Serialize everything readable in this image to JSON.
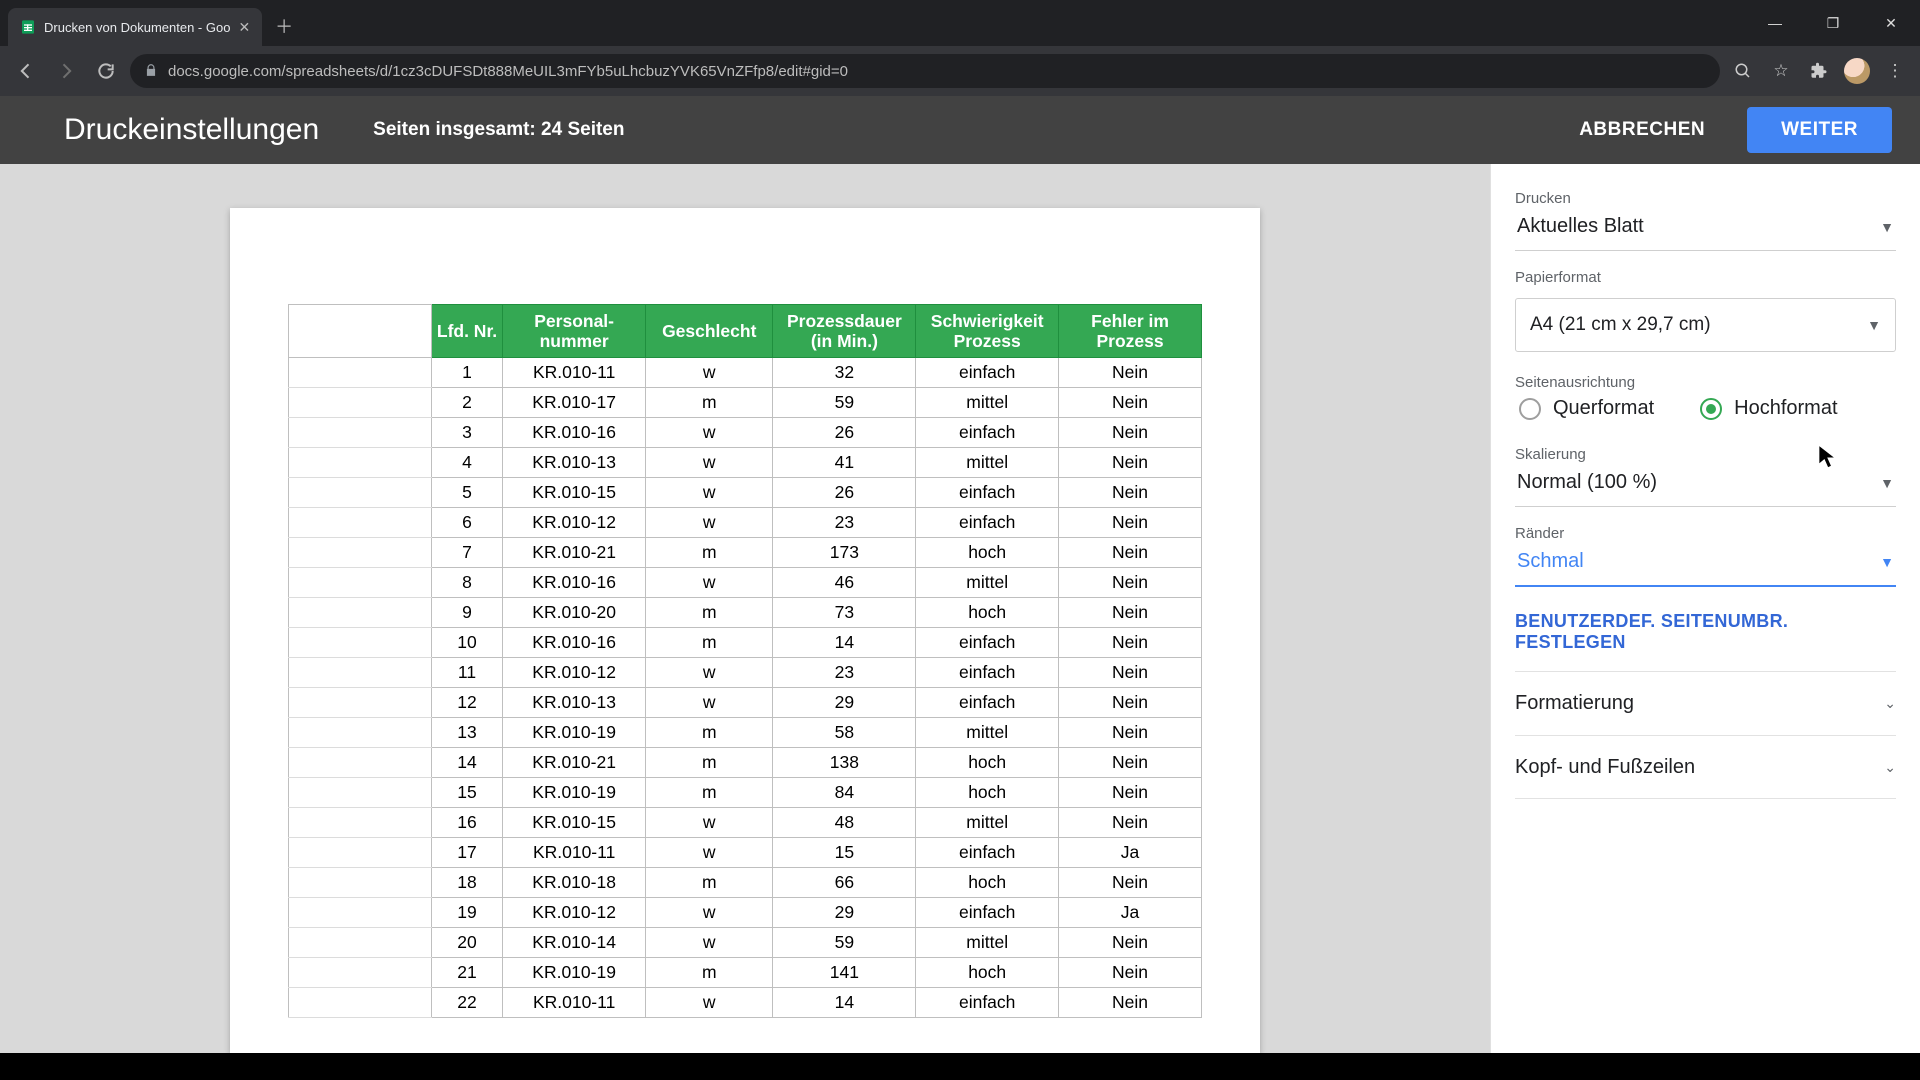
{
  "browser": {
    "tab_title": "Drucken von Dokumenten - Goo",
    "url": "docs.google.com/spreadsheets/d/1cz3cDUFSDt888MeUIL3mFYb5uLhcbuzYVK65VnZFfp8/edit#gid=0"
  },
  "bar": {
    "title": "Druckeinstellungen",
    "pages": "Seiten insgesamt: 24 Seiten",
    "cancel": "ABBRECHEN",
    "next": "WEITER"
  },
  "sidebar": {
    "print_label": "Drucken",
    "print_value": "Aktuelles Blatt",
    "paper_label": "Papierformat",
    "paper_value": "A4 (21 cm x 29,7 cm)",
    "orient_label": "Seitenausrichtung",
    "orient_landscape": "Querformat",
    "orient_portrait": "Hochformat",
    "scale_label": "Skalierung",
    "scale_value": "Normal (100 %)",
    "margin_label": "Ränder",
    "margin_value": "Schmal",
    "pagebreak": "BENUTZERDEF. SEITENUMBR. FESTLEGEN",
    "formatting": "Formatierung",
    "hf": "Kopf- und Fußzeilen"
  },
  "sheet": {
    "headers": [
      "Lfd. Nr.",
      "Personal-nummer",
      "Geschlecht",
      "Prozessdauer (in Min.)",
      "Schwierigkeit Prozess",
      "Fehler im Prozess"
    ],
    "rows": [
      [
        "1",
        "KR.010-11",
        "w",
        "32",
        "einfach",
        "Nein"
      ],
      [
        "2",
        "KR.010-17",
        "m",
        "59",
        "mittel",
        "Nein"
      ],
      [
        "3",
        "KR.010-16",
        "w",
        "26",
        "einfach",
        "Nein"
      ],
      [
        "4",
        "KR.010-13",
        "w",
        "41",
        "mittel",
        "Nein"
      ],
      [
        "5",
        "KR.010-15",
        "w",
        "26",
        "einfach",
        "Nein"
      ],
      [
        "6",
        "KR.010-12",
        "w",
        "23",
        "einfach",
        "Nein"
      ],
      [
        "7",
        "KR.010-21",
        "m",
        "173",
        "hoch",
        "Nein"
      ],
      [
        "8",
        "KR.010-16",
        "w",
        "46",
        "mittel",
        "Nein"
      ],
      [
        "9",
        "KR.010-20",
        "m",
        "73",
        "hoch",
        "Nein"
      ],
      [
        "10",
        "KR.010-16",
        "m",
        "14",
        "einfach",
        "Nein"
      ],
      [
        "11",
        "KR.010-12",
        "w",
        "23",
        "einfach",
        "Nein"
      ],
      [
        "12",
        "KR.010-13",
        "w",
        "29",
        "einfach",
        "Nein"
      ],
      [
        "13",
        "KR.010-19",
        "m",
        "58",
        "mittel",
        "Nein"
      ],
      [
        "14",
        "KR.010-21",
        "m",
        "138",
        "hoch",
        "Nein"
      ],
      [
        "15",
        "KR.010-19",
        "m",
        "84",
        "hoch",
        "Nein"
      ],
      [
        "16",
        "KR.010-15",
        "w",
        "48",
        "mittel",
        "Nein"
      ],
      [
        "17",
        "KR.010-11",
        "w",
        "15",
        "einfach",
        "Ja"
      ],
      [
        "18",
        "KR.010-18",
        "m",
        "66",
        "hoch",
        "Nein"
      ],
      [
        "19",
        "KR.010-12",
        "w",
        "29",
        "einfach",
        "Ja"
      ],
      [
        "20",
        "KR.010-14",
        "w",
        "59",
        "mittel",
        "Nein"
      ],
      [
        "21",
        "KR.010-19",
        "m",
        "141",
        "hoch",
        "Nein"
      ],
      [
        "22",
        "KR.010-11",
        "w",
        "14",
        "einfach",
        "Nein"
      ]
    ]
  }
}
